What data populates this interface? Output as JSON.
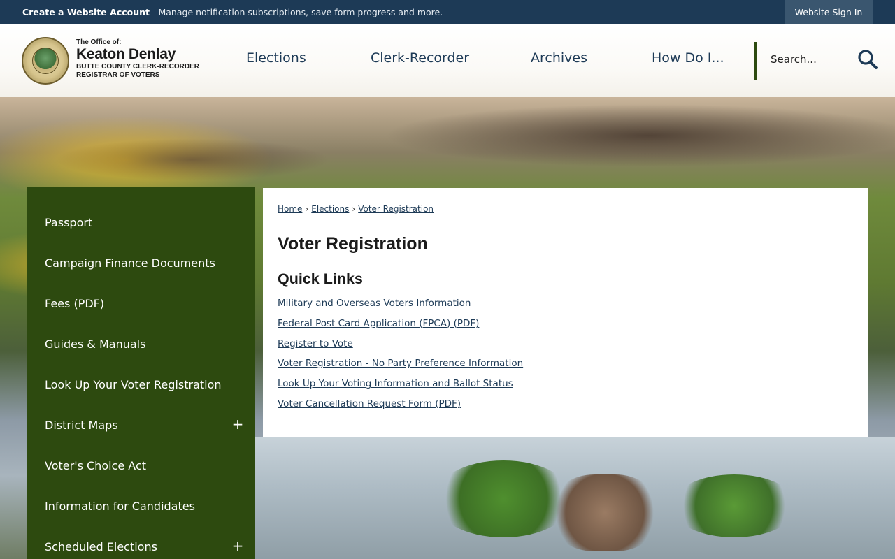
{
  "topbar": {
    "create_account": "Create a Website Account",
    "message": "- Manage notification subscriptions, save form progress and more.",
    "sign_in": "Website Sign In"
  },
  "header": {
    "logo": {
      "line1": "The Office of:",
      "name": "Keaton Denlay",
      "line3": "BUTTE COUNTY CLERK-RECORDER",
      "line4": "REGISTRAR OF VOTERS"
    },
    "nav": [
      {
        "label": "Elections"
      },
      {
        "label": "Clerk-Recorder"
      },
      {
        "label": "Archives"
      },
      {
        "label": "How Do I..."
      }
    ],
    "search": {
      "placeholder": "Search..."
    }
  },
  "sidebar": {
    "items": [
      {
        "label": "Passport"
      },
      {
        "label": "Campaign Finance Documents"
      },
      {
        "label": "Fees (PDF)"
      },
      {
        "label": "Guides & Manuals"
      },
      {
        "label": "Look Up Your Voter Registration"
      },
      {
        "label": "District Maps",
        "toggle": "+"
      },
      {
        "label": "Voter's Choice Act"
      },
      {
        "label": "Information for Candidates"
      },
      {
        "label": "Scheduled Elections",
        "toggle": "+"
      }
    ]
  },
  "breadcrumb": [
    {
      "label": "Home"
    },
    {
      "label": "Elections"
    },
    {
      "label": "Voter Registration"
    }
  ],
  "breadcrumb_sep": "›",
  "main": {
    "title": "Voter Registration",
    "quick_links_title": "Quick Links",
    "links": [
      {
        "label": "Military and Overseas Voters Information"
      },
      {
        "label": "Federal Post Card Application (FPCA) (PDF)"
      },
      {
        "label": "Register to Vote"
      },
      {
        "label": "Voter Registration - No Party Preference Information"
      },
      {
        "label": "Look Up Your Voting Information and Ballot Status"
      },
      {
        "label": "Voter Cancellation Request Form (PDF)"
      }
    ]
  },
  "colors": {
    "topbar": "#1d3a56",
    "nav_text": "#1d3a56",
    "sidebar": "#2d4a0f",
    "link": "#1d3a56"
  }
}
